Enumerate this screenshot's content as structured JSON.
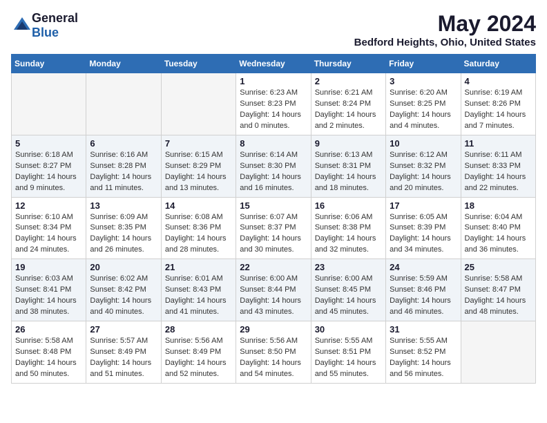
{
  "logo": {
    "general": "General",
    "blue": "Blue"
  },
  "title": "May 2024",
  "location": "Bedford Heights, Ohio, United States",
  "days_of_week": [
    "Sunday",
    "Monday",
    "Tuesday",
    "Wednesday",
    "Thursday",
    "Friday",
    "Saturday"
  ],
  "weeks": [
    [
      {
        "day": "",
        "sunrise": "",
        "sunset": "",
        "daylight": ""
      },
      {
        "day": "",
        "sunrise": "",
        "sunset": "",
        "daylight": ""
      },
      {
        "day": "",
        "sunrise": "",
        "sunset": "",
        "daylight": ""
      },
      {
        "day": "1",
        "sunrise": "Sunrise: 6:23 AM",
        "sunset": "Sunset: 8:23 PM",
        "daylight": "Daylight: 14 hours and 0 minutes."
      },
      {
        "day": "2",
        "sunrise": "Sunrise: 6:21 AM",
        "sunset": "Sunset: 8:24 PM",
        "daylight": "Daylight: 14 hours and 2 minutes."
      },
      {
        "day": "3",
        "sunrise": "Sunrise: 6:20 AM",
        "sunset": "Sunset: 8:25 PM",
        "daylight": "Daylight: 14 hours and 4 minutes."
      },
      {
        "day": "4",
        "sunrise": "Sunrise: 6:19 AM",
        "sunset": "Sunset: 8:26 PM",
        "daylight": "Daylight: 14 hours and 7 minutes."
      }
    ],
    [
      {
        "day": "5",
        "sunrise": "Sunrise: 6:18 AM",
        "sunset": "Sunset: 8:27 PM",
        "daylight": "Daylight: 14 hours and 9 minutes."
      },
      {
        "day": "6",
        "sunrise": "Sunrise: 6:16 AM",
        "sunset": "Sunset: 8:28 PM",
        "daylight": "Daylight: 14 hours and 11 minutes."
      },
      {
        "day": "7",
        "sunrise": "Sunrise: 6:15 AM",
        "sunset": "Sunset: 8:29 PM",
        "daylight": "Daylight: 14 hours and 13 minutes."
      },
      {
        "day": "8",
        "sunrise": "Sunrise: 6:14 AM",
        "sunset": "Sunset: 8:30 PM",
        "daylight": "Daylight: 14 hours and 16 minutes."
      },
      {
        "day": "9",
        "sunrise": "Sunrise: 6:13 AM",
        "sunset": "Sunset: 8:31 PM",
        "daylight": "Daylight: 14 hours and 18 minutes."
      },
      {
        "day": "10",
        "sunrise": "Sunrise: 6:12 AM",
        "sunset": "Sunset: 8:32 PM",
        "daylight": "Daylight: 14 hours and 20 minutes."
      },
      {
        "day": "11",
        "sunrise": "Sunrise: 6:11 AM",
        "sunset": "Sunset: 8:33 PM",
        "daylight": "Daylight: 14 hours and 22 minutes."
      }
    ],
    [
      {
        "day": "12",
        "sunrise": "Sunrise: 6:10 AM",
        "sunset": "Sunset: 8:34 PM",
        "daylight": "Daylight: 14 hours and 24 minutes."
      },
      {
        "day": "13",
        "sunrise": "Sunrise: 6:09 AM",
        "sunset": "Sunset: 8:35 PM",
        "daylight": "Daylight: 14 hours and 26 minutes."
      },
      {
        "day": "14",
        "sunrise": "Sunrise: 6:08 AM",
        "sunset": "Sunset: 8:36 PM",
        "daylight": "Daylight: 14 hours and 28 minutes."
      },
      {
        "day": "15",
        "sunrise": "Sunrise: 6:07 AM",
        "sunset": "Sunset: 8:37 PM",
        "daylight": "Daylight: 14 hours and 30 minutes."
      },
      {
        "day": "16",
        "sunrise": "Sunrise: 6:06 AM",
        "sunset": "Sunset: 8:38 PM",
        "daylight": "Daylight: 14 hours and 32 minutes."
      },
      {
        "day": "17",
        "sunrise": "Sunrise: 6:05 AM",
        "sunset": "Sunset: 8:39 PM",
        "daylight": "Daylight: 14 hours and 34 minutes."
      },
      {
        "day": "18",
        "sunrise": "Sunrise: 6:04 AM",
        "sunset": "Sunset: 8:40 PM",
        "daylight": "Daylight: 14 hours and 36 minutes."
      }
    ],
    [
      {
        "day": "19",
        "sunrise": "Sunrise: 6:03 AM",
        "sunset": "Sunset: 8:41 PM",
        "daylight": "Daylight: 14 hours and 38 minutes."
      },
      {
        "day": "20",
        "sunrise": "Sunrise: 6:02 AM",
        "sunset": "Sunset: 8:42 PM",
        "daylight": "Daylight: 14 hours and 40 minutes."
      },
      {
        "day": "21",
        "sunrise": "Sunrise: 6:01 AM",
        "sunset": "Sunset: 8:43 PM",
        "daylight": "Daylight: 14 hours and 41 minutes."
      },
      {
        "day": "22",
        "sunrise": "Sunrise: 6:00 AM",
        "sunset": "Sunset: 8:44 PM",
        "daylight": "Daylight: 14 hours and 43 minutes."
      },
      {
        "day": "23",
        "sunrise": "Sunrise: 6:00 AM",
        "sunset": "Sunset: 8:45 PM",
        "daylight": "Daylight: 14 hours and 45 minutes."
      },
      {
        "day": "24",
        "sunrise": "Sunrise: 5:59 AM",
        "sunset": "Sunset: 8:46 PM",
        "daylight": "Daylight: 14 hours and 46 minutes."
      },
      {
        "day": "25",
        "sunrise": "Sunrise: 5:58 AM",
        "sunset": "Sunset: 8:47 PM",
        "daylight": "Daylight: 14 hours and 48 minutes."
      }
    ],
    [
      {
        "day": "26",
        "sunrise": "Sunrise: 5:58 AM",
        "sunset": "Sunset: 8:48 PM",
        "daylight": "Daylight: 14 hours and 50 minutes."
      },
      {
        "day": "27",
        "sunrise": "Sunrise: 5:57 AM",
        "sunset": "Sunset: 8:49 PM",
        "daylight": "Daylight: 14 hours and 51 minutes."
      },
      {
        "day": "28",
        "sunrise": "Sunrise: 5:56 AM",
        "sunset": "Sunset: 8:49 PM",
        "daylight": "Daylight: 14 hours and 52 minutes."
      },
      {
        "day": "29",
        "sunrise": "Sunrise: 5:56 AM",
        "sunset": "Sunset: 8:50 PM",
        "daylight": "Daylight: 14 hours and 54 minutes."
      },
      {
        "day": "30",
        "sunrise": "Sunrise: 5:55 AM",
        "sunset": "Sunset: 8:51 PM",
        "daylight": "Daylight: 14 hours and 55 minutes."
      },
      {
        "day": "31",
        "sunrise": "Sunrise: 5:55 AM",
        "sunset": "Sunset: 8:52 PM",
        "daylight": "Daylight: 14 hours and 56 minutes."
      },
      {
        "day": "",
        "sunrise": "",
        "sunset": "",
        "daylight": ""
      }
    ]
  ]
}
